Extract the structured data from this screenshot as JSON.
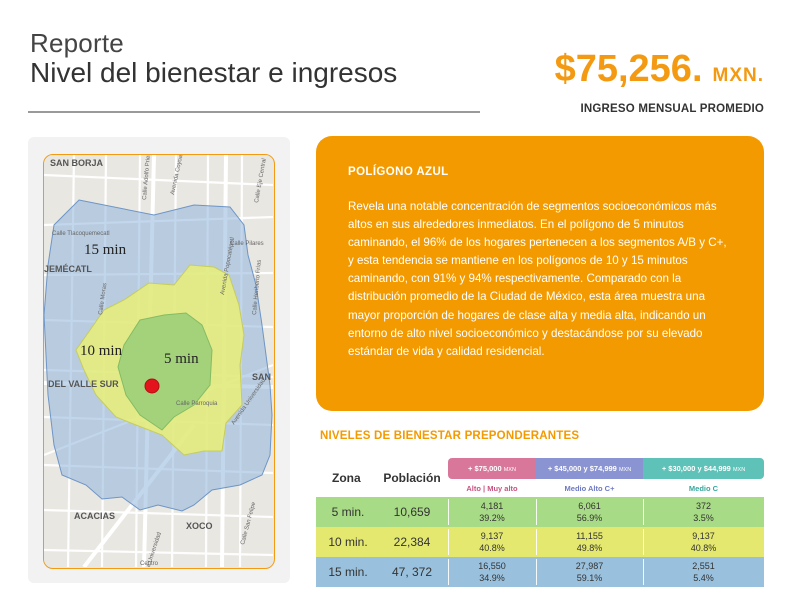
{
  "header": {
    "title_small": "Reporte",
    "title_big": "Nivel del bienestar e ingresos"
  },
  "kpi": {
    "value": "$75,256.",
    "unit": "MXN.",
    "label": "INGRESO MENSUAL PROMEDIO",
    "color": "#f39a12"
  },
  "map": {
    "labels": {
      "min15": "15 min",
      "min10": "10 min",
      "min5": "5 min"
    },
    "place_labels": [
      "SAN BORJA",
      "JEMÉCATL",
      "DEL VALLE SUR",
      "ACACIAS",
      "XOCO",
      "SAN"
    ],
    "street_labels": [
      "Avenida Coyoacán",
      "Calle Adolfo Prieto",
      "Calle Tlacoquemecatl",
      "Calle Pilares",
      "Calle Moras",
      "Avenida Universidad",
      "Calle Uxmal",
      "Avenida Popocatépetl",
      "Calle Eje Central",
      "Centro",
      "Calle San Felipe",
      "Avenida Universidad",
      "Calle Parroquia",
      "Calle Heriberto Frías"
    ],
    "colors": {
      "poly15": "#8fb4dd",
      "poly10": "#e9f078",
      "poly5": "#9ccf7a",
      "marker": "#e3141c"
    }
  },
  "info": {
    "title": "POLÍGONO AZUL",
    "body": "Revela una notable concentración de segmentos socioeconómicos más altos en sus alrededores inmediatos. En el polígono de 5 minutos caminando, el 96% de los hogares pertenecen a los segmentos A/B y C+, y esta tendencia se mantiene en los polígonos de 10 y 15 minutos caminando, con 91% y 94% respectivamente. Comparado con la distribución promedio de la Ciudad de México, esta área muestra una mayor proporción de hogares de clase alta y media alta, indicando un entorno de alto nivel socioeconómico y destacándose por su elevado estándar de vida y calidad residencial.",
    "background": "#f39a00"
  },
  "table": {
    "heading": "NIVELES DE BIENESTAR PREPONDERANTES",
    "col_zona": "Zona",
    "col_poblacion": "Población",
    "groups": [
      {
        "range": "+ $75,000",
        "unit": "MXN",
        "sub": "Alto | Muy alto",
        "color": "#d9779a",
        "sub_color": "#c9527f"
      },
      {
        "range": "+ $45,000 y $74,999",
        "unit": "MXN",
        "sub": "Medio Alto C+",
        "color": "#8a94d2",
        "sub_color": "#6e79c2"
      },
      {
        "range": "+ $30,000 y $44,999",
        "unit": "MXN",
        "sub": "Medio C",
        "color": "#5ec2b8",
        "sub_color": "#37a79c"
      }
    ],
    "rows": [
      {
        "zona": "5 min.",
        "poblacion": "10,659",
        "color": "#a8db85",
        "vals": [
          [
            "4,181",
            "39.2%"
          ],
          [
            "6,061",
            "56.9%"
          ],
          [
            "372",
            "3.5%"
          ]
        ]
      },
      {
        "zona": "10 min.",
        "poblacion": "22,384",
        "color": "#e5e86f",
        "vals": [
          [
            "9,137",
            "40.8%"
          ],
          [
            "11,155",
            "49.8%"
          ],
          [
            "9,137",
            "40.8%"
          ]
        ]
      },
      {
        "zona": "15 min.",
        "poblacion": "47, 372",
        "color": "#99c0dd",
        "vals": [
          [
            "16,550",
            "34.9%"
          ],
          [
            "27,987",
            "59.1%"
          ],
          [
            "2,551",
            "5.4%"
          ]
        ]
      }
    ]
  }
}
